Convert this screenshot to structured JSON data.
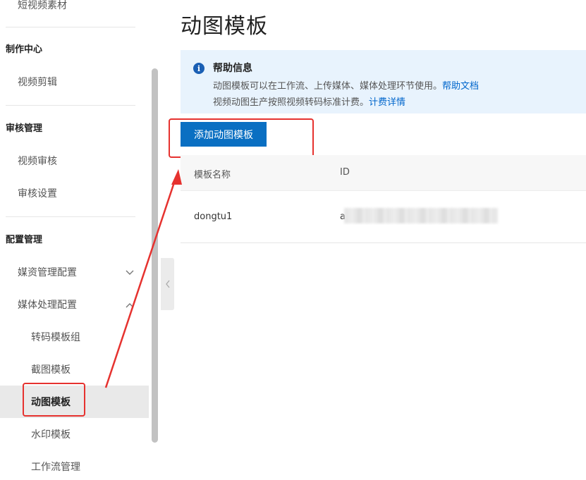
{
  "sidebar": {
    "top_item": "短视频素材",
    "groups": [
      {
        "title": "制作中心",
        "items": [
          "视频剪辑"
        ]
      },
      {
        "title": "审核管理",
        "items": [
          "视频审核",
          "审核设置"
        ]
      },
      {
        "title": "配置管理",
        "items": [
          "媒资管理配置",
          "媒体处理配置"
        ]
      }
    ],
    "sub_items": [
      "转码模板组",
      "截图模板",
      "动图模板",
      "水印模板",
      "工作流管理"
    ],
    "active": "动图模板"
  },
  "main": {
    "title": "动图模板",
    "help": {
      "title": "帮助信息",
      "line1": "动图模板可以在工作流、上传媒体、媒体处理环节使用。",
      "line1_link": "帮助文档",
      "line2": "视频动图生产按照视频转码标准计费。",
      "line2_link": "计费详情"
    },
    "add_button": "添加动图模板",
    "table": {
      "columns": [
        "模板名称",
        "ID"
      ],
      "rows": [
        {
          "name": "dongtu1",
          "id": "a"
        }
      ]
    }
  },
  "colors": {
    "accent": "#0a6fc2",
    "highlight": "#e6322f",
    "help_bg": "#e8f3fd"
  }
}
